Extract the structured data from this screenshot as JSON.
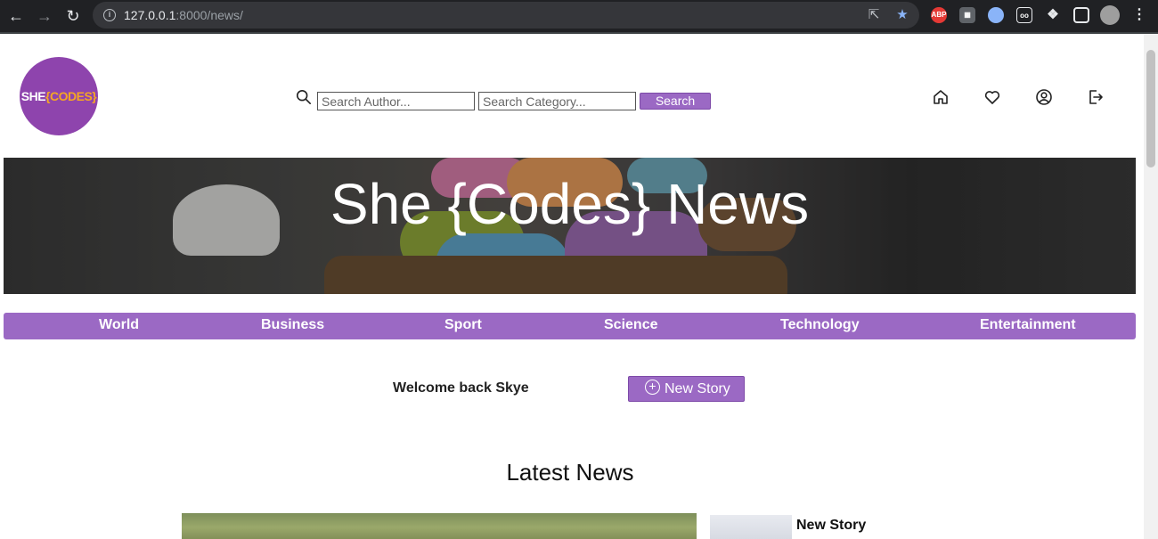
{
  "browser": {
    "url_host": "127.0.0.1",
    "url_rest": ":8000/news/"
  },
  "site": {
    "logo_text_main": "SHE",
    "logo_text_accent": "{CODES}",
    "search": {
      "author_placeholder": "Search Author...",
      "category_placeholder": "Search Category...",
      "button_label": "Search"
    },
    "nav_icons": [
      "home-icon",
      "heart-icon",
      "user-icon",
      "logout-icon"
    ],
    "hero_title": "She {Codes} News",
    "categories": [
      "World",
      "Business",
      "Sport",
      "Science",
      "Technology",
      "Entertainment"
    ],
    "welcome_text": "Welcome back Skye",
    "new_story_label": "New Story",
    "section_title": "Latest News",
    "stories": [
      {
        "title": "New Story"
      }
    ]
  },
  "colors": {
    "brand_purple": "#9b69c4",
    "logo_purple": "#8e44ad",
    "logo_accent": "#f5a623"
  }
}
